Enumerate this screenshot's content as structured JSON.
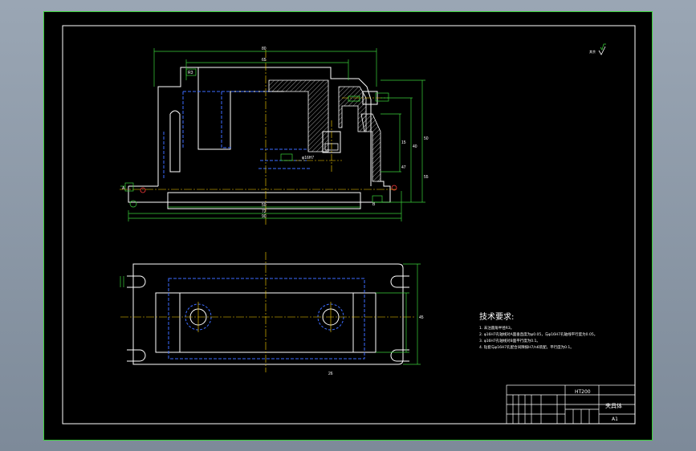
{
  "drawing": {
    "roughness_mark": "其余",
    "requirements": {
      "title": "技术要求:",
      "lines": [
        "1. 未注圆角半径R3。",
        "2. φ16H7孔轴线对A面垂直度为φ0.05，与φ16H7孔轴线平行度为0.05。",
        "3. φ16H7孔轴线对B面平行度为0.1。",
        "4. 钻套与φ16H7孔配合间隙按H7/n6装配，平行度为0.1。"
      ]
    },
    "title_block": {
      "material": "HT200",
      "name": "夹具体",
      "sheet": "A1"
    },
    "dims": {
      "top_overall": "80",
      "top_inner": "65",
      "r_label": "R3",
      "bore": "φ16H7",
      "right_1": "50",
      "right_2": "40",
      "right_3": "15",
      "right_4": "47",
      "right_5": "55",
      "bottom_1": "50",
      "bottom_2": "72",
      "bottom_3": "90",
      "left_a": "A",
      "left_b": "B",
      "plan_h": "45",
      "plan_w": "26"
    }
  }
}
